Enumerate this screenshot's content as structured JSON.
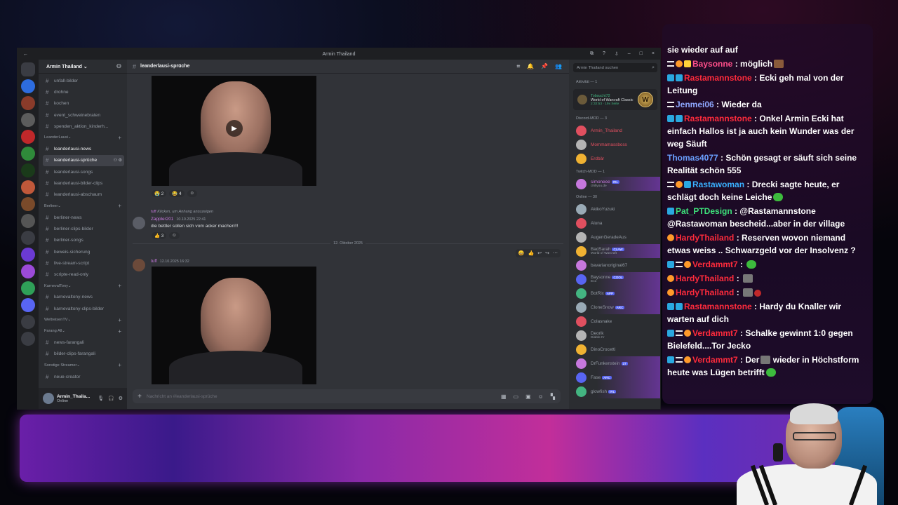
{
  "window": {
    "title": "Armin Thailand",
    "back_label": "←",
    "controls": [
      "⧉",
      "?",
      "⇩",
      "–",
      "□",
      "×"
    ]
  },
  "servers": [
    "discord-home",
    "server-1",
    "server-2",
    "server-3",
    "server-4",
    "server-5",
    "server-6",
    "server-7",
    "server-8",
    "server-9",
    "server-10",
    "server-11",
    "server-12",
    "server-13",
    "server-14",
    "add-server",
    "explore"
  ],
  "guild": {
    "name": "Armin Thailand ⌄",
    "channels_top": [
      "unfall-bilder",
      "drohne",
      "kochen",
      "event_schweinebraten",
      "spenden_aktion_kinderh..."
    ],
    "categories": [
      {
        "name": "LeanderLausi",
        "channels": [
          "leanderlausi-news",
          "leanderlausi-sprüche",
          "leanderlausi-songs",
          "leanderlausi-bilder-clips",
          "leanderlausi-abschaum"
        ]
      },
      {
        "name": "Berliner",
        "channels": [
          "berliner-news",
          "berliner-clips-bilder",
          "berliner-songs",
          "beweis-sicherung",
          "live-stream-script",
          "scripte-read-only"
        ]
      },
      {
        "name": "KarnevalTony",
        "channels": [
          "karnevaltony-news",
          "karnevaltony-clips-bilder"
        ]
      },
      {
        "name": "WeltreisenTV",
        "channels": []
      },
      {
        "name": "Farang All",
        "channels": [
          "news-farangali",
          "bilder-clips-farangali"
        ]
      },
      {
        "name": "Sonstige Streamer",
        "channels": [
          "neue-creator"
        ]
      }
    ]
  },
  "user_panel": {
    "name": "Armin_Thaila...",
    "status": "Online"
  },
  "channel": {
    "name": "leanderlausi-sprüche",
    "header_icons": [
      "threads-icon",
      "bell-icon",
      "pin-icon",
      "members-icon"
    ]
  },
  "messages": {
    "reactions_1": [
      "😭 2",
      "😂 4",
      "☺"
    ],
    "reply_user": "tuff",
    "reply_text": "Klicken, um Anhang anzuzeigen",
    "msg2_user": "Zappler201",
    "msg2_time": "10.10.2025 22:41",
    "msg2_text": "die bettler sollen sich vom acker machen!!!",
    "reactions_2": [
      "👍 3",
      "☺"
    ],
    "date_divider": "12. Oktober 2025",
    "msg3_user": "tuff",
    "msg3_time": "12.10.2025 16:32"
  },
  "composer": {
    "placeholder": "Nachricht an #leanderlausi-sprüche"
  },
  "members": {
    "search_placeholder": "Armin Thailand suchen",
    "activity_header": "Aktivität — 1",
    "activity_user": "Tobsucht72",
    "activity_game": "World of Warcraft Classic",
    "activity_meta": "2:32:53 · 19x Seite",
    "groups": [
      {
        "title": "Discord-MOD — 3",
        "members": [
          {
            "name": "Armin_Thailand",
            "sub": ""
          },
          {
            "name": "Mommamassboss",
            "sub": ""
          },
          {
            "name": "Erdbär",
            "sub": ""
          }
        ]
      },
      {
        "title": "Twitch-MOD — 1",
        "members": [
          {
            "name": "simoneee",
            "sub": "chillyou.de",
            "tag": "IRL"
          }
        ]
      },
      {
        "title": "Online — 30",
        "members": [
          {
            "name": "AkikoYuzuki",
            "sub": ""
          },
          {
            "name": "Aluna",
            "sub": ""
          },
          {
            "name": "AugenGeradeAus",
            "sub": ""
          },
          {
            "name": "BadSarah",
            "sub": "World of Warcraft",
            "tag": "CLAW"
          },
          {
            "name": "bavarianoriginal67",
            "sub": ""
          },
          {
            "name": "Baysonne",
            "sub": "Eco",
            "tag": "COOL"
          },
          {
            "name": "BotRix",
            "sub": "",
            "tag": "APP"
          },
          {
            "name": "CloneSnow",
            "sub": "",
            "tag": "ARC"
          },
          {
            "name": "Colasnake",
            "sub": ""
          },
          {
            "name": "Deorik",
            "sub": "Diablo IV"
          },
          {
            "name": "DinoCrocetti",
            "sub": ""
          },
          {
            "name": "DrFunkenstein",
            "sub": "",
            "tag": "ZT"
          },
          {
            "name": "Fase",
            "sub": "",
            "tag": "ARC"
          },
          {
            "name": "glowfish",
            "sub": "",
            "tag": "IRL"
          }
        ]
      }
    ]
  },
  "chat": {
    "lines": [
      {
        "user": "",
        "color": "#ffffff",
        "text": "sie wieder auf auf",
        "badges": ""
      },
      {
        "user": "Baysonne",
        "color": "#ff4f8a",
        "text": "möglich",
        "badges": "bar-coin-crown",
        "emote": "br"
      },
      {
        "user": "Rastamannstone",
        "color": "#ff2b3c",
        "text": "Ecki geh mal von der Leitung",
        "badges": "sq-sq"
      },
      {
        "user": "Jenmei06",
        "color": "#8fa8ff",
        "text": "Wieder da",
        "badges": "bar"
      },
      {
        "user": "Rastamannstone",
        "color": "#ff2b3c",
        "text": "Onkel Armin Ecki hat einfach Hallos ist ja auch kein Wunder was der weg Säuft",
        "badges": "sq-sq"
      },
      {
        "user": "Thomas4077",
        "color": "#6aa0ff",
        "text": "Schön gesagt er säuft sich seine Realität schön 555",
        "badges": ""
      },
      {
        "user": "Rastawoman",
        "color": "#3ab0ff",
        "text": "Drecki sagte heute, er schlägt doch keine Leiche",
        "badges": "bar-coin-sq",
        "emote": "gn"
      },
      {
        "user": "Pat_PTDesign",
        "color": "#3de07a",
        "text": "@Rastamannstone @Rastawoman bescheid...aber in der village",
        "badges": "sq"
      },
      {
        "user": "HardyThailand",
        "color": "#ff2b3c",
        "text": "Reserven wovon niemand etwas weiss .. Schwarzgeld vor der Insolvenz ?",
        "badges": "coin"
      },
      {
        "user": "Verdammt7",
        "color": "#ff2b3c",
        "text": "",
        "badges": "sq-bar-coin",
        "emote": "gn"
      },
      {
        "user": "HardyThailand",
        "color": "#ff2b3c",
        "text": "",
        "badges": "coin",
        "emote": "gr"
      },
      {
        "user": "HardyThailand",
        "color": "#ff2b3c",
        "text": "",
        "badges": "coin",
        "emote": "gr-rd"
      },
      {
        "user": "Rastamannstone",
        "color": "#ff2b3c",
        "text": "Hardy du Knaller wir warten auf dich",
        "badges": "sq-sq"
      },
      {
        "user": "Verdammt7",
        "color": "#ff2b3c",
        "text": "Schalke gewinnt 1:0 gegen Bielefeld....Tor Jecko",
        "badges": "sq-bar-coin"
      },
      {
        "user": "Verdammt7",
        "color": "#ff2b3c",
        "text": "Der",
        "text2": "wieder in Höchstform heute was Lügen betrifft",
        "badges": "sq-bar-coin",
        "emote": "gr-mid"
      }
    ]
  }
}
